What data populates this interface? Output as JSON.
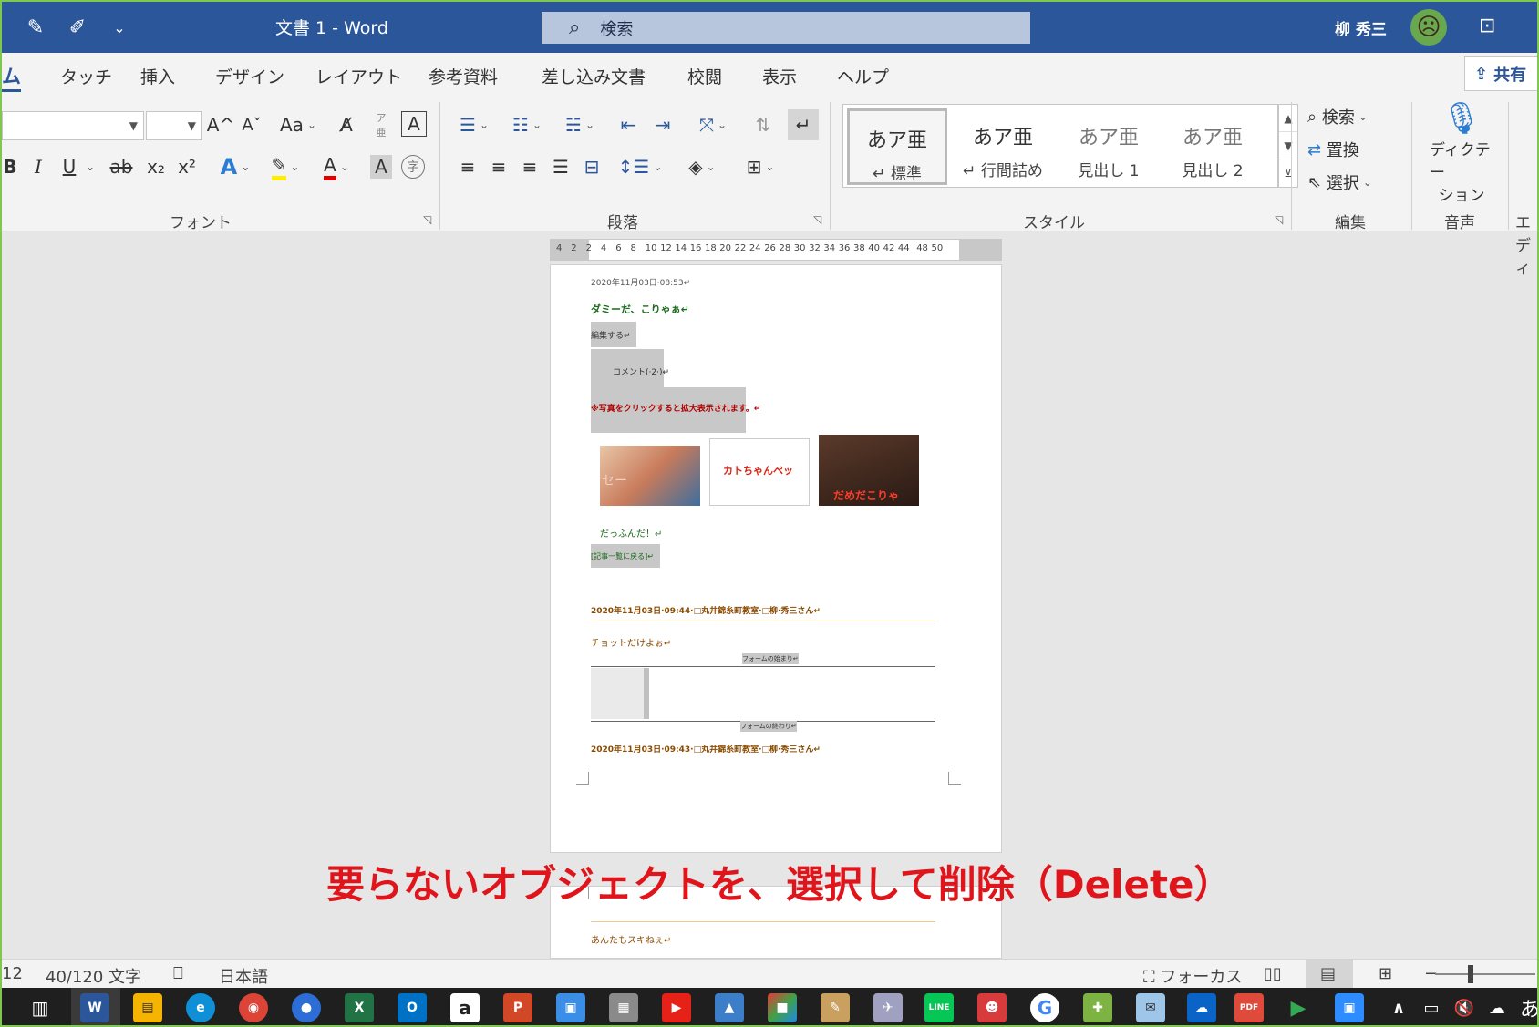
{
  "titlebar": {
    "doc_title": "文書 1  -  Word",
    "search_placeholder": "検索",
    "user_name": "柳 秀三"
  },
  "tabs": {
    "home_partial": "ム",
    "items": [
      "タッチ",
      "挿入",
      "デザイン",
      "レイアウト",
      "参考資料",
      "差し込み文書",
      "校閲",
      "表示",
      "ヘルプ"
    ],
    "share": "共有"
  },
  "ribbon": {
    "groups": {
      "font": "フォント",
      "paragraph": "段落",
      "styles": "スタイル",
      "editing": "編集",
      "voice": "音声",
      "editor_partial": "エディ"
    },
    "font_buttons": {
      "grow": "A^",
      "shrink": "Aˇ",
      "case": "Aa",
      "phonetic_top": "ア",
      "phonetic_bottom": "亜",
      "border_char": "A",
      "bold": "B",
      "italic": "I",
      "underline": "U",
      "strike": "ab",
      "subscript": "x₂",
      "superscript": "x²",
      "effects": "A",
      "font_color": "A",
      "char_shading": "A",
      "enclosed": "字"
    },
    "styles": [
      {
        "sample": "あア亜",
        "name": "↵ 標準"
      },
      {
        "sample": "あア亜",
        "name": "↵ 行間詰め"
      },
      {
        "sample": "あア亜",
        "name": "見出し 1"
      },
      {
        "sample": "あア亜",
        "name": "見出し 2"
      }
    ],
    "editing": {
      "find": "検索",
      "replace": "置換",
      "select": "選択"
    },
    "voice": {
      "dictate_line1": "ディクテー",
      "dictate_line2": "ション"
    }
  },
  "ruler": {
    "labels": [
      "4",
      "2",
      "2",
      "4",
      "6",
      "8",
      "10",
      "12",
      "14",
      "16",
      "18",
      "20",
      "22",
      "24",
      "26",
      "28",
      "30",
      "32",
      "34",
      "36",
      "38",
      "40",
      "42",
      "44",
      "48",
      "50"
    ]
  },
  "document": {
    "timestamp1": "2020年11月03日·08:53↵",
    "heading1": "ダミーだ、こりゃぁ↵",
    "edit_link": "編集する↵",
    "comment_link": "コメント(·2·)↵",
    "photo_note": "※写真をクリックすると拡大表示されます。↵",
    "caption": "だっふんだ！↵",
    "back_link": "[記事一覧に戻る]↵",
    "entry2_header": "2020年11月03日·09:44·□丸井錦糸町教室·□柳·秀三さん↵",
    "entry2_body": "チョットだけよぉ↵",
    "form_start": "フォームの始まり↵",
    "form_end": "フォームの終わり↵",
    "entry3_header": "2020年11月03日·09:43·□丸井錦糸町教室·□柳·秀三さん↵",
    "page2_text": "あんたもスキねぇ↵",
    "image1_text": "セー",
    "image2_text": "カトちゃんペッ",
    "image3_text": "だめだこりゃ"
  },
  "annotation": "要らないオブジェクトを、選択して削除（Delete）",
  "statusbar": {
    "page_partial": "12",
    "word_count": "40/120 文字",
    "language": "日本語",
    "focus": "フォーカス"
  },
  "taskbar": {
    "icons": [
      "W",
      "▤",
      "e",
      "◉",
      "●",
      "X",
      "O",
      "a",
      "P",
      "▣",
      "▦",
      "▶",
      "▲",
      "■",
      "✎",
      "✈",
      "LINE",
      "☻",
      "G",
      "✚",
      "✉",
      "☁",
      "PDF",
      "▶",
      "▣"
    ],
    "ime": "あ"
  },
  "colors": {
    "word_blue": "#2b579a",
    "annotation_red": "#e0151c",
    "frame_green": "#7ec850"
  }
}
